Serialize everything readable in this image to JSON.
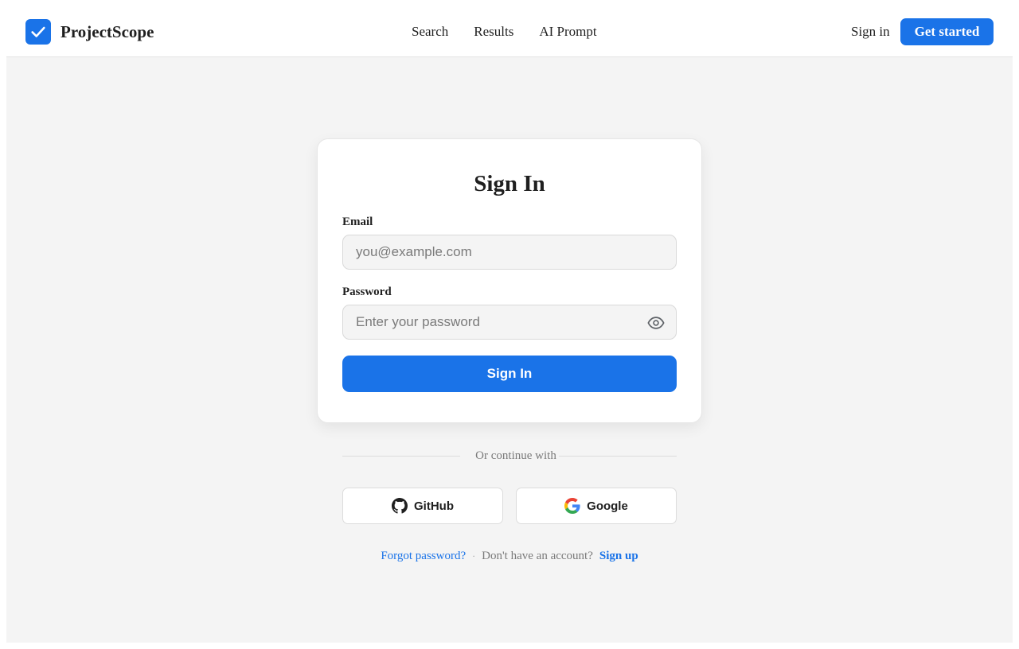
{
  "header": {
    "brand": "ProjectScope",
    "nav": [
      "Search",
      "Results",
      "AI Prompt"
    ],
    "sign_in": "Sign in",
    "get_started": "Get started"
  },
  "card": {
    "title": "Sign In",
    "email_label": "Email",
    "email_placeholder": "you@example.com",
    "password_label": "Password",
    "password_placeholder": "Enter your password",
    "submit_label": "Sign In"
  },
  "social": {
    "divider_text": "Or continue with",
    "github_label": "GitHub",
    "google_label": "Google"
  },
  "footer": {
    "forgot": "Forgot password?",
    "separator": "·",
    "no_account": "Don't have an account?",
    "signup": "Sign up"
  },
  "colors": {
    "accent": "#1a73e8",
    "page_bg": "#f4f4f4",
    "text": "#1f1f1f",
    "muted": "#7a7a7a"
  },
  "icons": [
    "checkmark-logo-icon",
    "eye-icon",
    "github-icon",
    "google-icon"
  ]
}
